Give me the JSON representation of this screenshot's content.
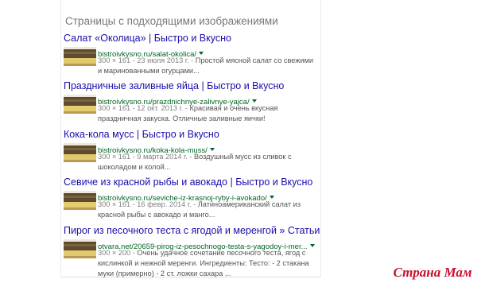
{
  "section_title": "Страницы с подходящими изображениями",
  "results": [
    {
      "title": "Салат «Околица» | Быстро и Вкусно",
      "url": "bistroivkysno.ru/salat-okolica/",
      "meta": "300 × 161 - 23 июля 2013 г. -",
      "snippet": "Простой мясной салат со свежими и маринованными огурцами..."
    },
    {
      "title": "Праздничные заливные яйца | Быстро и Вкусно",
      "url": "bistroivkysno.ru/prazdnichnye-zalivnye-yajca/",
      "meta": "300 × 161 - 12 окт. 2013 г. -",
      "snippet": "Красивая и очень вкусная праздничная закуска. Отличные заливные яички!"
    },
    {
      "title": "Кока-кола мусс | Быстро и Вкусно",
      "url": "bistroivkysno.ru/koka-kola-muss/",
      "meta": "300 × 161 - 9 марта 2014 г. -",
      "snippet": "Воздушный мусс из сливок с шоколадом и колой..."
    },
    {
      "title": "Севиче из красной рыбы и авокадо | Быстро и Вкусно",
      "url": "bistroivkysno.ru/seviche-iz-krasnoj-ryby-i-avokado/",
      "meta": "300 × 161 - 16 февр. 2014 г. -",
      "snippet": "Латиноамериканский салат из красной рыбы с авокадо и манго..."
    },
    {
      "title": "Пирог из песочного теста с ягодой и меренгой » Статьи ...",
      "url": "otvara.net/20659-pirog-iz-pesochnogo-testa-s-yagodoy-i-mer...",
      "meta": "300 × 200 -",
      "snippet": "Очень удачное сочетание песочного теста, ягод с кислинкой и нежной меренги. Ингредиенты: Тесто: - 2 стакана муки (примерно) - 2 ст. ложки сахара ..."
    }
  ],
  "watermark": {
    "text": "Страна Мам",
    "color": "#c8102e"
  }
}
